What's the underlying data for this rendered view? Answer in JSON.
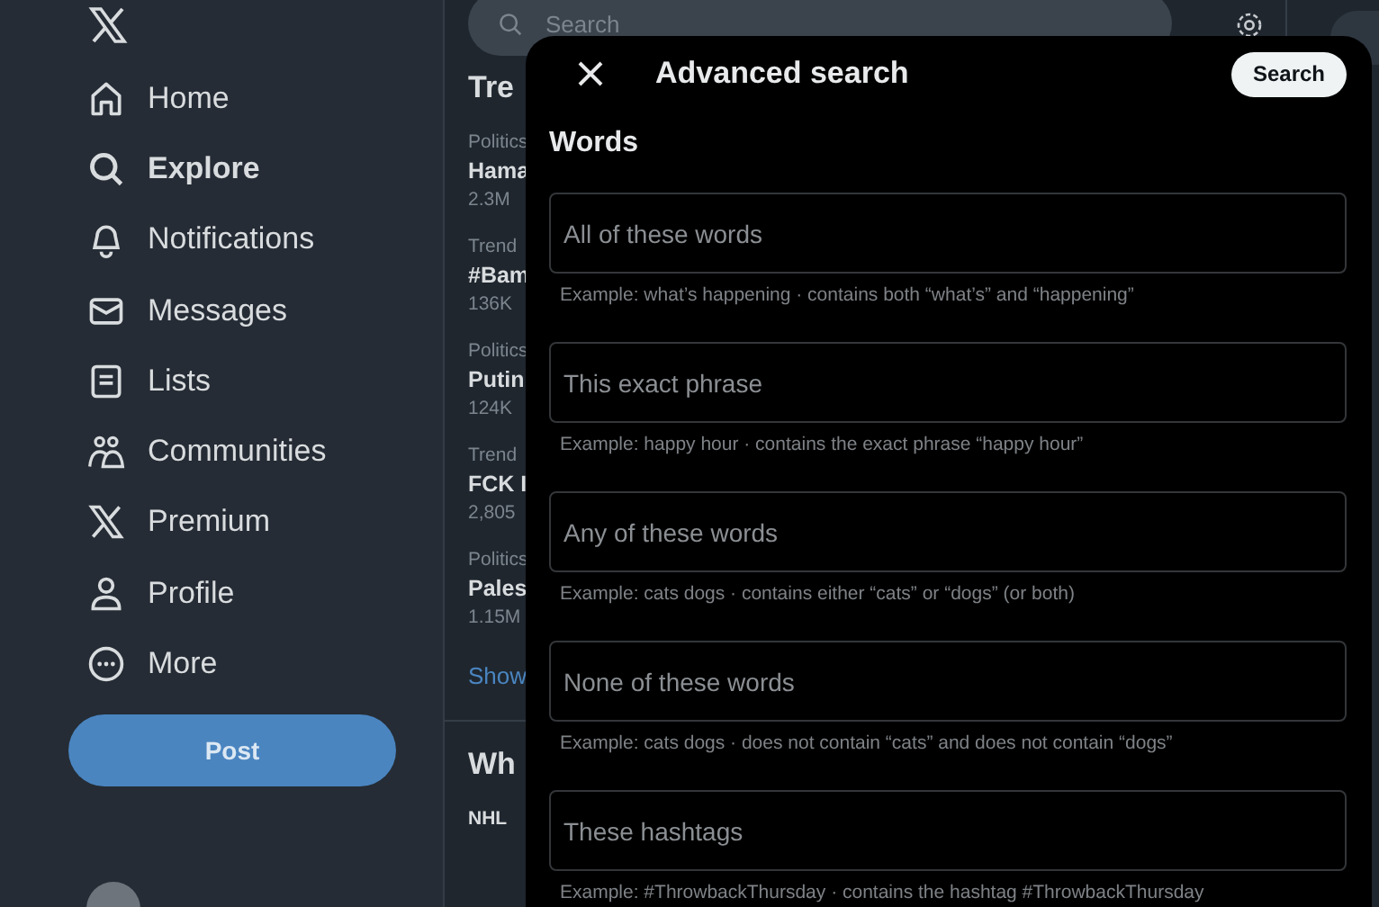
{
  "sidebar": {
    "items": [
      {
        "label": "Home",
        "selected": false
      },
      {
        "label": "Explore",
        "selected": true
      },
      {
        "label": "Notifications",
        "selected": false
      },
      {
        "label": "Messages",
        "selected": false
      },
      {
        "label": "Lists",
        "selected": false
      },
      {
        "label": "Communities",
        "selected": false
      },
      {
        "label": "Premium",
        "selected": false
      },
      {
        "label": "Profile",
        "selected": false
      },
      {
        "label": "More",
        "selected": false
      }
    ],
    "post_button": "Post"
  },
  "explore": {
    "search": {
      "placeholder": "Search"
    },
    "trends_title": "Tre",
    "trends": [
      {
        "category": "Politics",
        "name": "Hama",
        "count": "2.3M"
      },
      {
        "category": "Trend",
        "name": "#Bam",
        "count": "136K"
      },
      {
        "category": "Politics",
        "name": "Putin",
        "count": "124K"
      },
      {
        "category": "Trend",
        "name": "FCK I",
        "count": "2,805"
      },
      {
        "category": "Politics",
        "name": "Pales",
        "count": "1.15M"
      }
    ],
    "show_more": "Show",
    "section_title": "Wh",
    "section_item": "NHL"
  },
  "dialog": {
    "title": "Advanced search",
    "search_button": "Search",
    "section": "Words",
    "fields": [
      {
        "placeholder": "All of these words",
        "hint": "Example: what’s happening · contains both “what’s” and “happening”"
      },
      {
        "placeholder": "This exact phrase",
        "hint": "Example: happy hour · contains the exact phrase “happy hour”"
      },
      {
        "placeholder": "Any of these words",
        "hint": "Example: cats dogs · contains either “cats” or “dogs” (or both)"
      },
      {
        "placeholder": "None of these words",
        "hint": "Example: cats dogs · does not contain “cats” and does not contain “dogs”"
      },
      {
        "placeholder": "These hashtags",
        "hint": "Example: #ThrowbackThursday · contains the hashtag #ThrowbackThursday"
      }
    ]
  }
}
